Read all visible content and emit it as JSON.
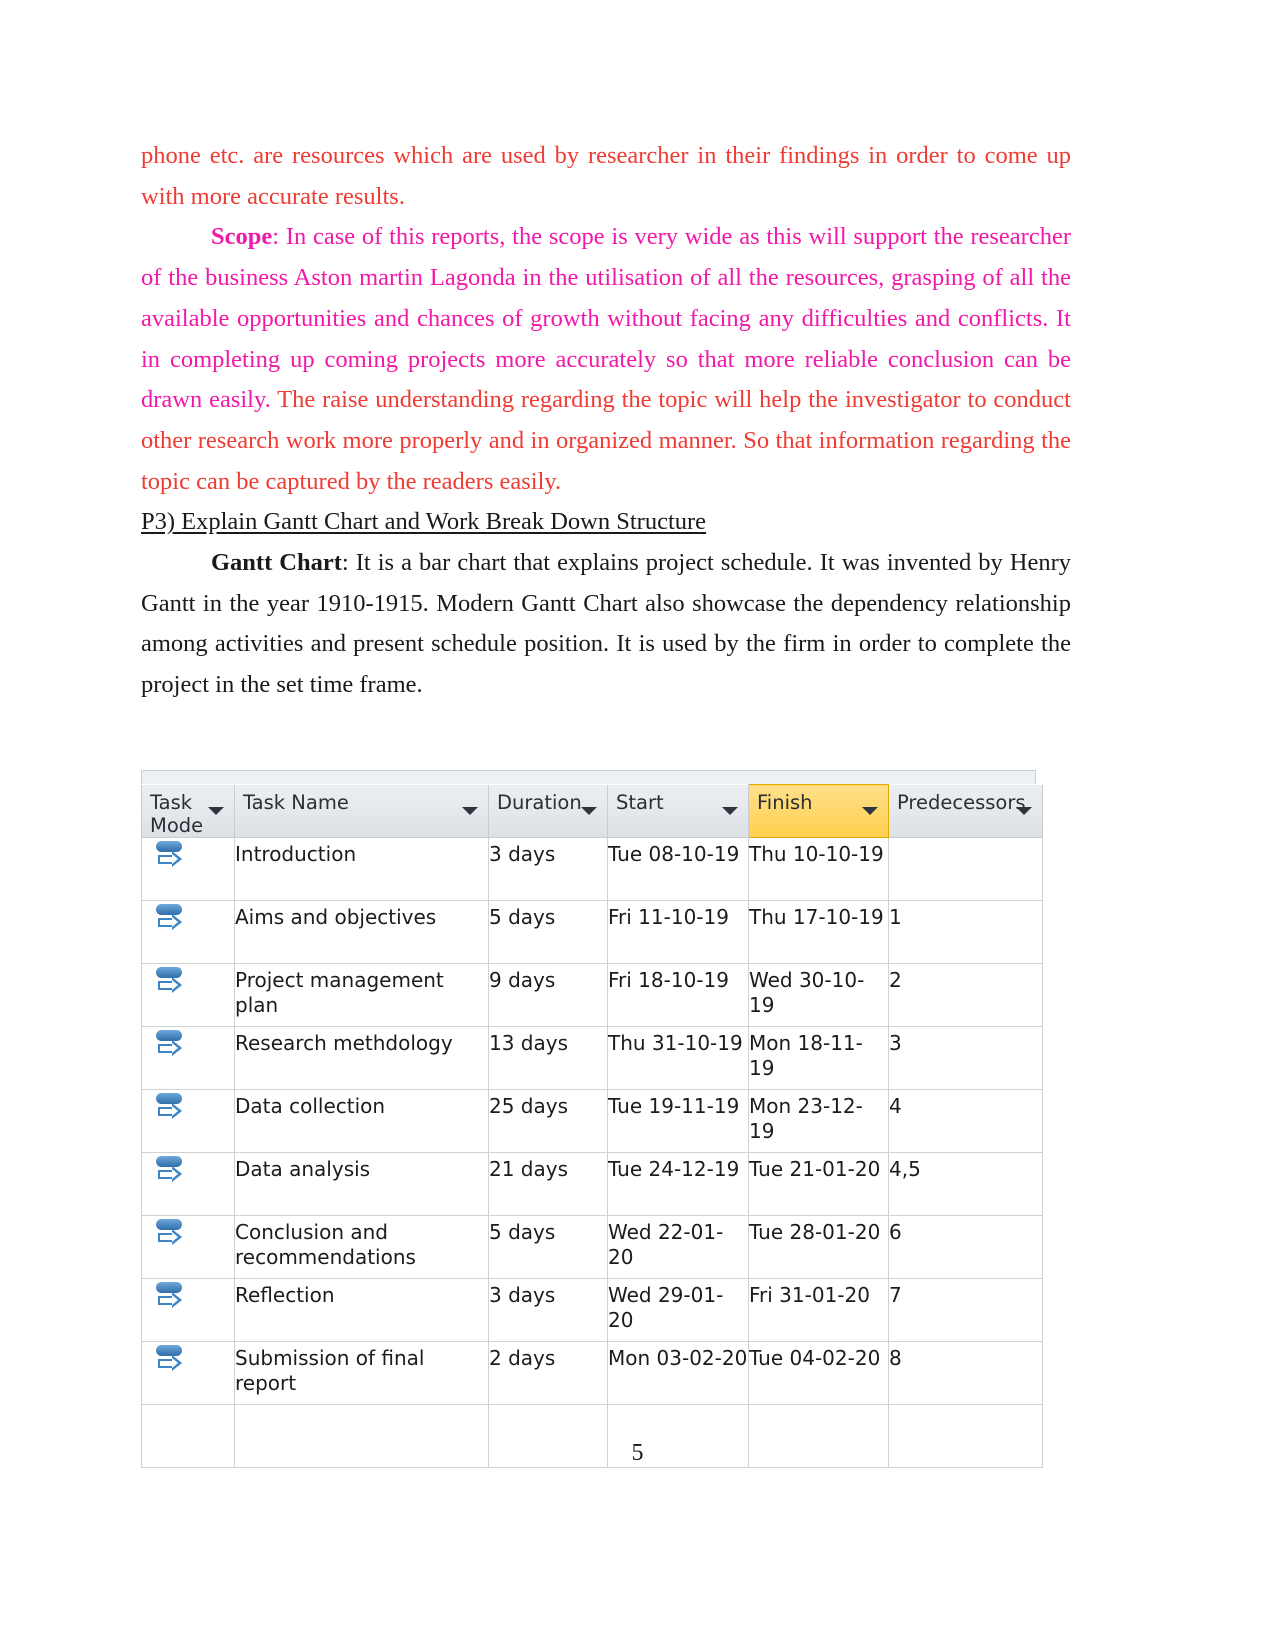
{
  "document": {
    "page_number": "5",
    "colors": {
      "red": "#ef3b33",
      "magenta": "#f218a8",
      "black": "#1a1a1a",
      "header_highlight": "#ffcf4d"
    },
    "paragraphs": {
      "p1_red": "phone etc.  are resources which are used by researcher in their findings in order to come up with more accurate results.",
      "p2_bold_lead": "Scope",
      "p2_magenta": ": In case of this reports, the scope is very wide as this will support the researcher of the business Aston martin Lagonda in the utilisation of all the resources, grasping of all the available opportunities and chances of growth without facing any difficulties and conflicts. It in completing up coming projects more accurately so that more reliable conclusion can be drawn easily.",
      "p2_red_tail": " The raise understanding regarding the topic will help the investigator to conduct other research work more properly and in organized manner. So that information regarding the topic can be captured by the readers easily.",
      "heading_p3": "P3) Explain Gantt Chart and Work Break Down Structure",
      "p3_bold_lead": "Gantt Chart",
      "p3_black": ": It is a bar chart that explains project schedule. It was invented by Henry Gantt in the year 1910-1915. Modern Gantt Chart also showcase the dependency relationship among activities and present schedule position. It is used by the firm in order to complete the project in the set time frame."
    }
  },
  "project_table": {
    "columns": [
      {
        "key": "task_mode",
        "label": "Task\nMode",
        "has_filter": true,
        "highlighted": false
      },
      {
        "key": "task_name",
        "label": "Task Name",
        "has_filter": true,
        "highlighted": false
      },
      {
        "key": "duration",
        "label": "Duration",
        "has_filter": true,
        "highlighted": false
      },
      {
        "key": "start",
        "label": "Start",
        "has_filter": true,
        "highlighted": false
      },
      {
        "key": "finish",
        "label": "Finish",
        "has_filter": true,
        "highlighted": true
      },
      {
        "key": "predecessors",
        "label": "Predecessors",
        "has_filter": true,
        "highlighted": false
      }
    ],
    "mode_icon_name": "auto-scheduled-icon",
    "rows": [
      {
        "mode": "auto-scheduled-icon",
        "name": "Introduction",
        "duration": "3 days",
        "start": "Tue 08-10-19",
        "finish": "Thu 10-10-19",
        "predecessors": ""
      },
      {
        "mode": "auto-scheduled-icon",
        "name": "Aims and objectives",
        "duration": "5 days",
        "start": "Fri 11-10-19",
        "finish": "Thu 17-10-19",
        "predecessors": "1"
      },
      {
        "mode": "auto-scheduled-icon",
        "name": "Project management plan",
        "duration": "9 days",
        "start": "Fri 18-10-19",
        "finish": "Wed 30-10-19",
        "predecessors": "2"
      },
      {
        "mode": "auto-scheduled-icon",
        "name": "Research methdology",
        "duration": "13 days",
        "start": "Thu 31-10-19",
        "finish": "Mon 18-11-19",
        "predecessors": "3"
      },
      {
        "mode": "auto-scheduled-icon",
        "name": "Data collection",
        "duration": "25 days",
        "start": "Tue 19-11-19",
        "finish": "Mon 23-12-19",
        "predecessors": "4"
      },
      {
        "mode": "auto-scheduled-icon",
        "name": "Data analysis",
        "duration": "21 days",
        "start": "Tue 24-12-19",
        "finish": "Tue 21-01-20",
        "predecessors": "4,5"
      },
      {
        "mode": "auto-scheduled-icon",
        "name": "Conclusion and recommendations",
        "duration": "5 days",
        "start": "Wed 22-01-20",
        "finish": "Tue 28-01-20",
        "predecessors": "6"
      },
      {
        "mode": "auto-scheduled-icon",
        "name": "Reflection",
        "duration": "3 days",
        "start": "Wed 29-01-20",
        "finish": "Fri 31-01-20",
        "predecessors": "7"
      },
      {
        "mode": "auto-scheduled-icon",
        "name": "Submission of final report",
        "duration": "2 days",
        "start": "Mon 03-02-20",
        "finish": "Tue 04-02-20",
        "predecessors": "8"
      }
    ]
  }
}
